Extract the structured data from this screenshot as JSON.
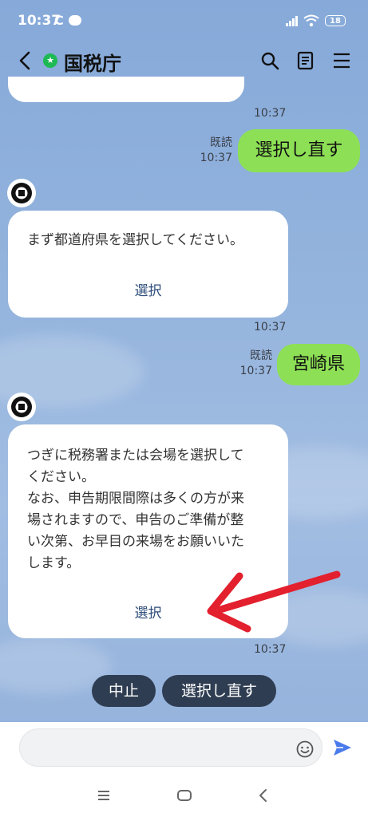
{
  "status_bar": {
    "time": "10:37",
    "c_icon": "C",
    "battery": "18"
  },
  "header": {
    "title": "国税庁"
  },
  "messages": {
    "partial_time": "10:37",
    "m1": {
      "read": "既読",
      "time": "10:37",
      "text": "選択し直す"
    },
    "m2": {
      "text": "まず都道府県を選択してください。",
      "link": "選択",
      "time": "10:37"
    },
    "m3": {
      "read": "既読",
      "time": "10:37",
      "text": "宮崎県"
    },
    "m4": {
      "lines": [
        "つぎに税務署または会場を選択して",
        "ください。",
        "なお、申告期限間際は多くの方が来",
        "場されますので、申告のご準備が整",
        "い次第、お早目の来場をお願いいた",
        "します。"
      ],
      "link": "選択",
      "time": "10:37"
    }
  },
  "quick_replies": {
    "cancel": "中止",
    "reselect": "選択し直す"
  },
  "input": {
    "placeholder": ""
  },
  "annotation": {
    "arrow_color": "#e3202e"
  }
}
